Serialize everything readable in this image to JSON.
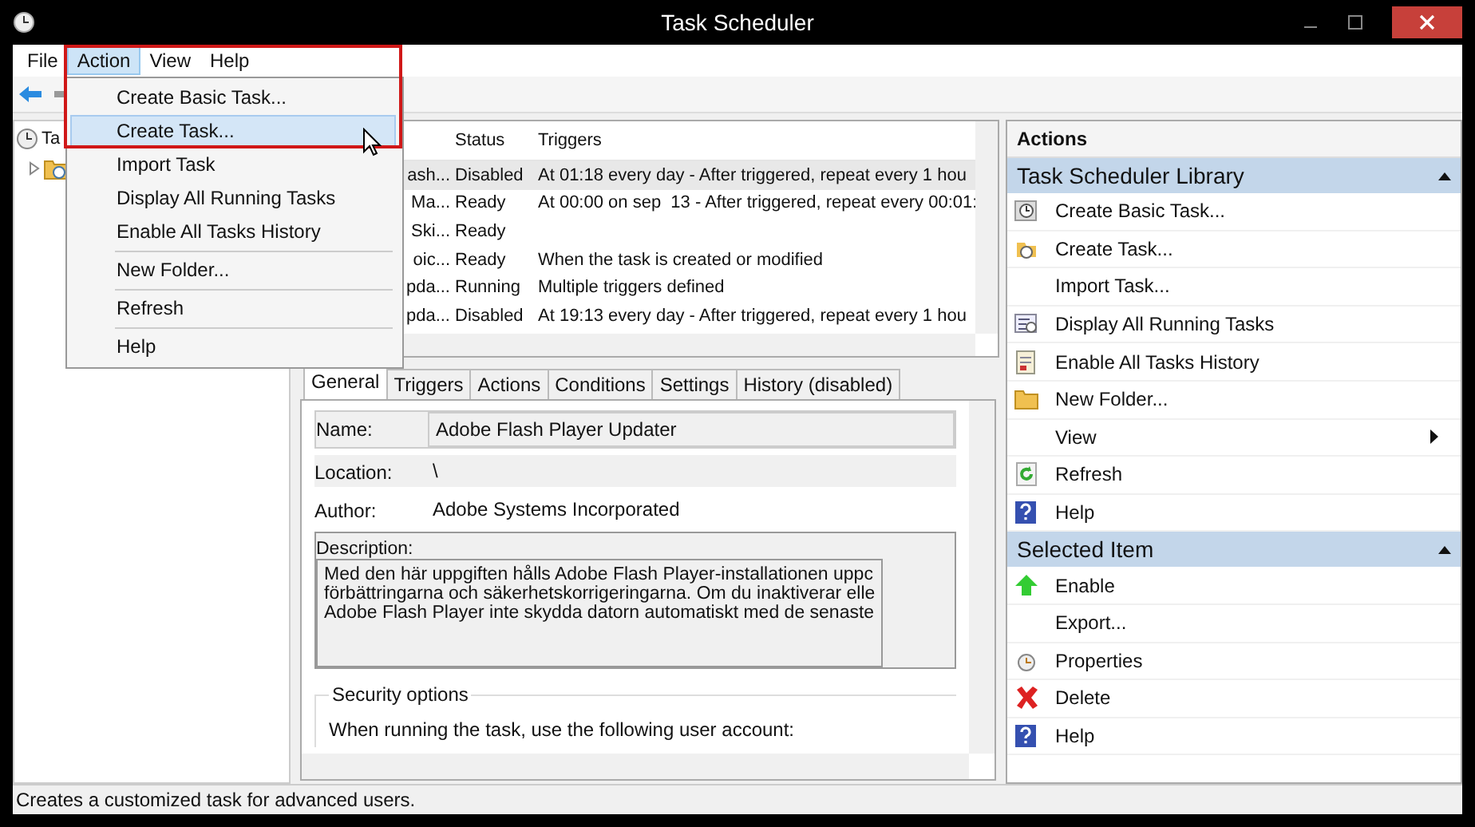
{
  "window": {
    "title": "Task Scheduler"
  },
  "menu_bar": [
    {
      "label": "File",
      "selected": false
    },
    {
      "label": "Action",
      "selected": true
    },
    {
      "label": "View",
      "selected": false
    },
    {
      "label": "Help",
      "selected": false
    }
  ],
  "action_menu": {
    "groups": [
      [
        {
          "label": "Create Basic Task...",
          "selected": false
        },
        {
          "label": "Create Task...",
          "selected": true
        },
        {
          "label": "Import Task",
          "selected": false
        },
        {
          "label": "Display All Running Tasks",
          "selected": false
        },
        {
          "label": "Enable All Tasks History",
          "selected": false
        }
      ],
      [
        {
          "label": "New Folder...",
          "selected": false
        }
      ],
      [
        {
          "label": "Refresh",
          "selected": false
        }
      ],
      [
        {
          "label": "Help",
          "selected": false
        }
      ]
    ]
  },
  "tree": [
    {
      "label": "Ta",
      "children": [
        {
          "expanded": false
        }
      ]
    }
  ],
  "task_list": {
    "columns": [
      "Status",
      "Triggers"
    ],
    "rows": [
      {
        "name": "ash...",
        "status": "Disabled",
        "trigger": "At 01:18 every day - After triggered, repeat every 1 hou",
        "selected": true
      },
      {
        "name": "Ma...",
        "status": "Ready",
        "trigger": "At 00:00 on sep  13 - After triggered, repeat every 00:01:",
        "selected": false
      },
      {
        "name": "Ski...",
        "status": "Ready",
        "selected": false
      },
      {
        "name": "oic...",
        "status": "Ready",
        "trigger": "When the task is created or modified",
        "selected": false
      },
      {
        "name": "pda...",
        "status": "Running",
        "trigger": "Multiple triggers defined",
        "selected": false
      },
      {
        "name": "pda...",
        "status": "Disabled",
        "trigger": "At 19:13 every day - After triggered, repeat every 1 hou",
        "selected": false
      }
    ]
  },
  "tabs": [
    {
      "label": "General",
      "selected": true
    },
    {
      "label": "Triggers",
      "selected": false
    },
    {
      "label": "Actions",
      "selected": false
    },
    {
      "label": "Conditions",
      "selected": false
    },
    {
      "label": "Settings",
      "selected": false
    },
    {
      "label": "History (disabled)",
      "selected": false
    }
  ],
  "general": {
    "fields": [
      {
        "label": "Name:",
        "kind": "box",
        "value": "Adobe Flash Player Updater"
      },
      {
        "label": "Location:",
        "kind": "shaded",
        "value": "\\"
      },
      {
        "label": "Author:",
        "kind": "plain",
        "value": "Adobe Systems Incorporated"
      },
      {
        "label": "Description:",
        "kind": "area",
        "lines": [
          "Med den här uppgiften hålls Adobe Flash Player-installationen uppc",
          "förbättringarna och säkerhetskorrigeringarna. Om du inaktiverar elle",
          "Adobe Flash Player inte skydda datorn automatiskt med de senaste"
        ]
      }
    ],
    "security": {
      "title": "Security options",
      "text": "When running the task, use the following user account:"
    }
  },
  "actions_pane": {
    "title": "Actions",
    "sections": [
      {
        "title": "Task Scheduler Library",
        "expanded": true,
        "items": [
          {
            "label": "Create Basic Task...",
            "kind": "clock-card",
            "submenu": false
          },
          {
            "label": "Create Task...",
            "kind": "clock-folder",
            "submenu": false
          },
          {
            "label": "Import Task...",
            "kind": "plain",
            "submenu": false
          },
          {
            "label": "Display All Running Tasks",
            "kind": "list",
            "submenu": false
          },
          {
            "label": "Enable All Tasks History",
            "kind": "history",
            "submenu": false
          },
          {
            "label": "New Folder...",
            "kind": "folder",
            "submenu": false
          },
          {
            "label": "View",
            "kind": "plain",
            "submenu": true
          },
          {
            "label": "Refresh",
            "kind": "refresh",
            "submenu": false
          },
          {
            "label": "Help",
            "kind": "help",
            "submenu": false
          }
        ]
      },
      {
        "title": "Selected Item",
        "expanded": true,
        "items": [
          {
            "label": "Enable",
            "kind": "enable",
            "submenu": false
          },
          {
            "label": "Export...",
            "kind": "plain",
            "submenu": false
          },
          {
            "label": "Properties",
            "kind": "clock",
            "submenu": false
          },
          {
            "label": "Delete",
            "kind": "delete",
            "submenu": false
          },
          {
            "label": "Help",
            "kind": "help",
            "submenu": false
          }
        ]
      }
    ]
  },
  "status_bar": "Creates a customized task for advanced users."
}
